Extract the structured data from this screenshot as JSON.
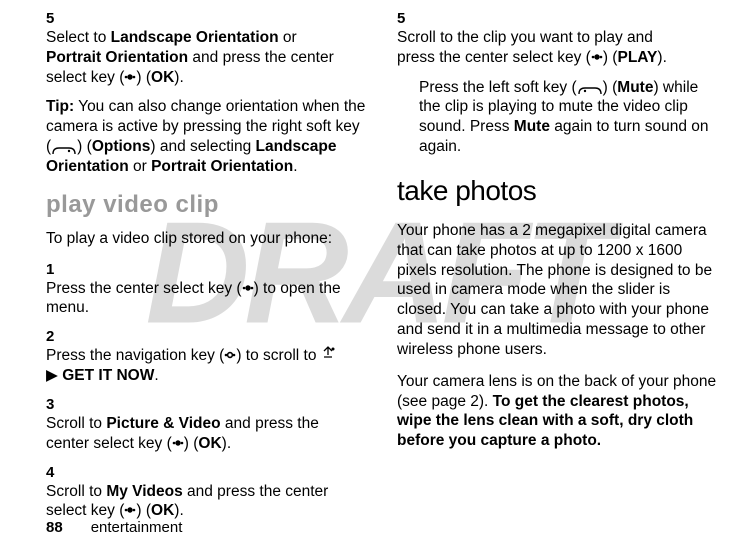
{
  "watermark": "DRAFT",
  "left": {
    "step5_num": "5",
    "step5_a": "Select to ",
    "step5_land": "Landscape Orientation",
    "step5_or": " or ",
    "step5_port": "Portrait Orientation",
    "step5_b": " and press the center select key (",
    "step5_c": ") (",
    "step5_ok": "OK",
    "step5_d": ").",
    "tip_label": "Tip:",
    "tip_a": " You can also change orientation when the camera is active by pressing the right soft key (",
    "tip_b": ") (",
    "tip_options": "Options",
    "tip_c": ") and selecting ",
    "tip_land": "Landscape Orientation",
    "tip_or": " or ",
    "tip_port": "Portrait Orientation",
    "tip_d": ".",
    "play_heading": "play video clip",
    "play_intro": "To play a video clip stored on your phone:",
    "s1_num": "1",
    "s1_a": "Press the center select key (",
    "s1_b": ") to open the menu.",
    "s2_num": "2",
    "s2_a": "Press the navigation key (",
    "s2_b": ") to scroll to ",
    "s2_get": "GET IT NOW",
    "s2_c": ".",
    "s3_num": "3",
    "s3_a": "Scroll to ",
    "s3_pic": "Picture & Video",
    "s3_b": " and press the center select key (",
    "s3_c": ") (",
    "s3_ok": "OK",
    "s3_d": ").",
    "s4_num": "4",
    "s4_a": "Scroll to ",
    "s4_my": "My Videos",
    "s4_b": " and press the center select key (",
    "s4_c": ") (",
    "s4_ok": "OK",
    "s4_d": ")."
  },
  "right": {
    "step5_num": "5",
    "step5_a": "Scroll to the clip you want to play and press the center select key (",
    "step5_b": ") (",
    "step5_play": "PLAY",
    "step5_c": ").",
    "p2_a": "Press the left soft key (",
    "p2_b": ") (",
    "p2_mute": "Mute",
    "p2_c": ") while the clip is playing to mute the video clip sound. Press ",
    "p2_mute2": "Mute",
    "p2_d": " again to turn sound on again.",
    "take_heading": "take photos",
    "tp1": "Your phone has a 2 megapixel digital camera that can take photos at up to 1200 x 1600 pixels resolution. The phone is designed to be used in camera mode when the slider is closed. You can take a photo with your phone and send it in a multimedia message to other wireless phone users.",
    "tp2_a": "Your camera lens is on the back of your phone (see page 2). ",
    "tp2_b": "To get the clearest photos, wipe the lens clean with a soft, dry cloth before you capture a photo."
  },
  "footer": {
    "page": "88",
    "section": "entertainment"
  }
}
